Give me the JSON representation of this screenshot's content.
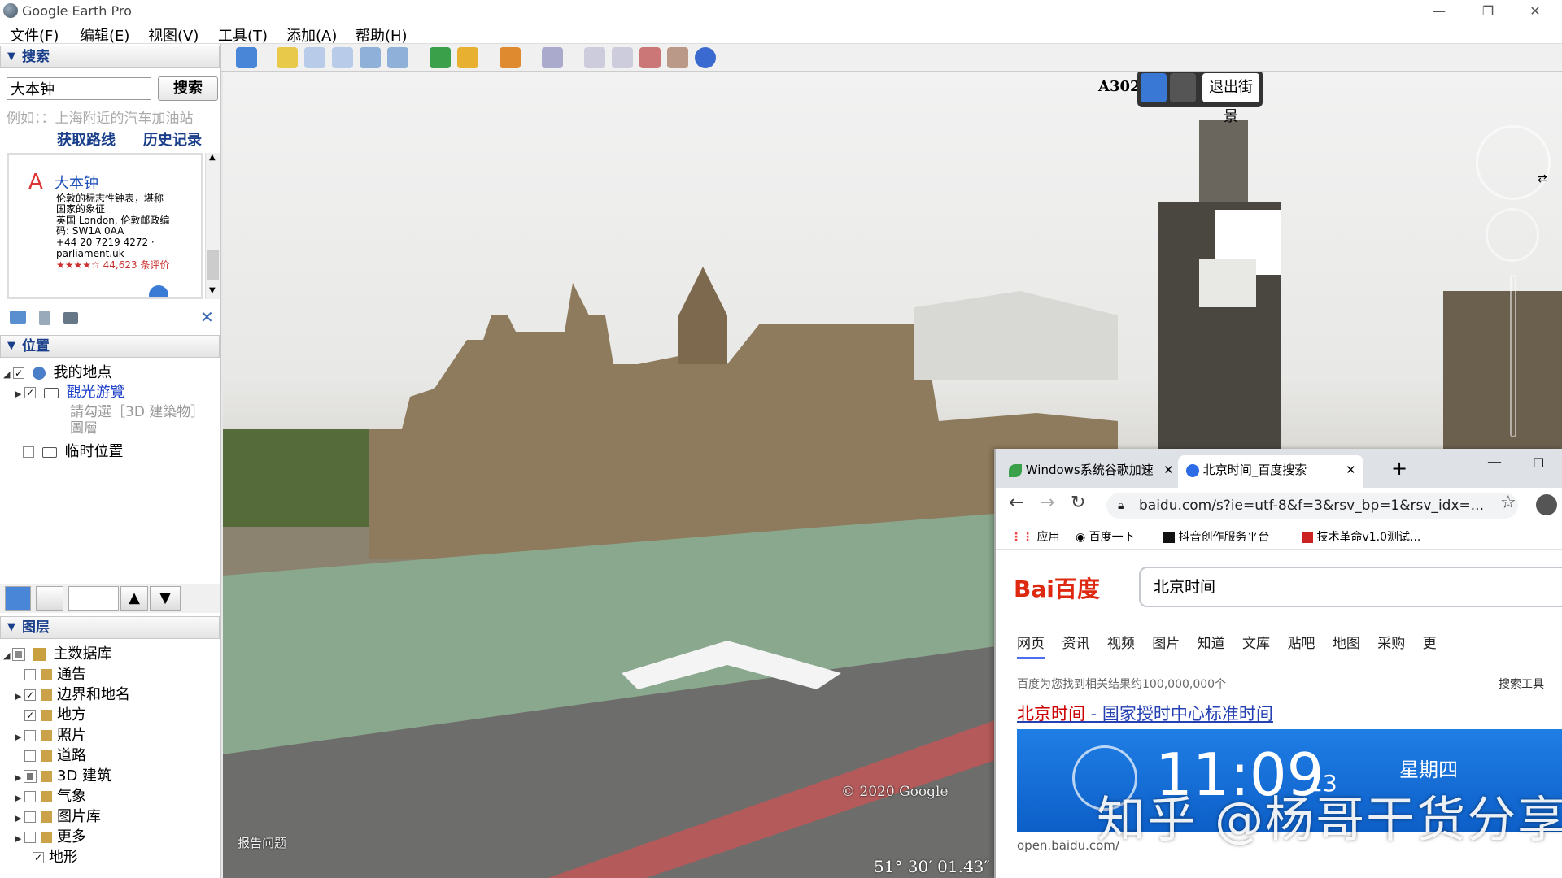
{
  "window": {
    "title": "Google Earth Pro",
    "controls": [
      "minimize-icon",
      "restore-icon",
      "close-icon"
    ]
  },
  "menu": [
    "文件(F)",
    "编辑(E)",
    "视图(V)",
    "工具(T)",
    "添加(A)",
    "帮助(H)"
  ],
  "search": {
    "header": "搜索",
    "input_value": "大本钟",
    "button": "搜索",
    "hint": "例如：：上海附近的汽车加油站",
    "links": [
      "获取路线",
      "历史记录"
    ],
    "result": {
      "marker": "A",
      "title": "大本钟",
      "lines": [
        "伦敦的标志性钟表，堪称",
        "国家的象征",
        "英国 London, 伦敦邮政编",
        "码: SW1A 0AA",
        "+44 20 7219 4272 ·",
        "parliament.uk",
        "★★★★☆ 44,623 条评价"
      ]
    }
  },
  "places": {
    "header": "位置",
    "my_places": "我的地点",
    "tour": "觀光游覽",
    "tour_note_1": "請勾選［3D 建築物］",
    "tour_note_2": "圖層",
    "temp": "临时位置"
  },
  "layers": {
    "header": "图层",
    "root": "主数据库",
    "items": [
      {
        "label": "通告",
        "checked": false
      },
      {
        "label": "边界和地名",
        "checked": true
      },
      {
        "label": "地方",
        "checked": true
      },
      {
        "label": "照片",
        "checked": false
      },
      {
        "label": "道路",
        "checked": false
      },
      {
        "label": "3D 建筑",
        "checked": "partial"
      },
      {
        "label": "气象",
        "checked": false
      },
      {
        "label": "图片库",
        "checked": false
      },
      {
        "label": "更多",
        "checked": false
      },
      {
        "label": "地形",
        "checked": true
      }
    ]
  },
  "map": {
    "road_label": "A302",
    "exit_streetview": "退出街景",
    "copyright": "© 2020 Google",
    "report": "报告问题",
    "coords": "51° 30′ 01.43″"
  },
  "browser": {
    "tabs": [
      {
        "label": "Windows系统谷歌加速",
        "active": false
      },
      {
        "label": "北京时间_百度搜索",
        "active": true
      }
    ],
    "new_tab": "+",
    "url": "baidu.com/s?ie=utf-8&f=3&rsv_bp=1&rsv_idx=...",
    "bookmarks": [
      "应用",
      "百度一下",
      "抖音创作服务平台",
      "技术革命v1.0测试..."
    ],
    "page": {
      "logo": "Bai百度",
      "query": "北京时间",
      "tabs": [
        "网页",
        "资讯",
        "视频",
        "图片",
        "知道",
        "文库",
        "贴吧",
        "地图",
        "采购",
        "更"
      ],
      "count": "百度为您找到相关结果约100,000,000个",
      "filter": "搜索工具",
      "result_title_hl": "北京时间",
      "result_title_rest": " - 国家授时中心标准时间",
      "clock_time": "11:09",
      "clock_sec": "13",
      "clock_day": "星期四",
      "source_url": "open.baidu.com/"
    }
  },
  "watermark": "知乎 @杨哥干货分享"
}
